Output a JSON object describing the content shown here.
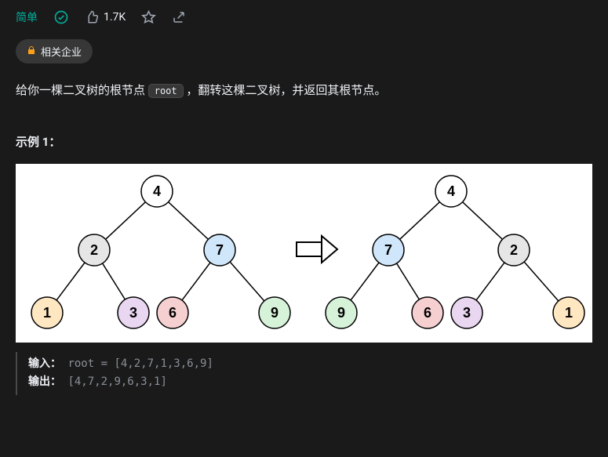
{
  "topbar": {
    "difficulty": "简单",
    "likes": "1.7K"
  },
  "tag": {
    "label": "相关企业"
  },
  "problem": {
    "text_before": "给你一棵二叉树的根节点 ",
    "code": "root",
    "text_after": " ，翻转这棵二叉树，并返回其根节点。"
  },
  "example": {
    "heading": "示例 1：",
    "input_label": "输入：",
    "input_value": "root = [4,2,7,1,3,6,9]",
    "output_label": "输出：",
    "output_value": "[4,7,2,9,6,3,1]"
  },
  "chart_data": {
    "type": "diagram",
    "description": "Binary tree inversion example",
    "trees": [
      {
        "label": "input",
        "root": 4,
        "edges": [
          [
            4,
            2
          ],
          [
            4,
            7
          ],
          [
            2,
            1
          ],
          [
            2,
            3
          ],
          [
            7,
            6
          ],
          [
            7,
            9
          ]
        ],
        "levels": [
          [
            4
          ],
          [
            2,
            7
          ],
          [
            1,
            3,
            6,
            9
          ]
        ]
      },
      {
        "label": "output",
        "root": 4,
        "edges": [
          [
            4,
            7
          ],
          [
            4,
            2
          ],
          [
            7,
            9
          ],
          [
            7,
            6
          ],
          [
            2,
            3
          ],
          [
            2,
            1
          ]
        ],
        "levels": [
          [
            4
          ],
          [
            7,
            2
          ],
          [
            9,
            6,
            3,
            1
          ]
        ]
      }
    ],
    "node_colors": {
      "4": "#ffffff",
      "2": "#e6e6e6",
      "7": "#cfe6fb",
      "1": "#ffe7c2",
      "3": "#e9d6f0",
      "6": "#f6cfd1",
      "9": "#d6f2d9"
    }
  }
}
